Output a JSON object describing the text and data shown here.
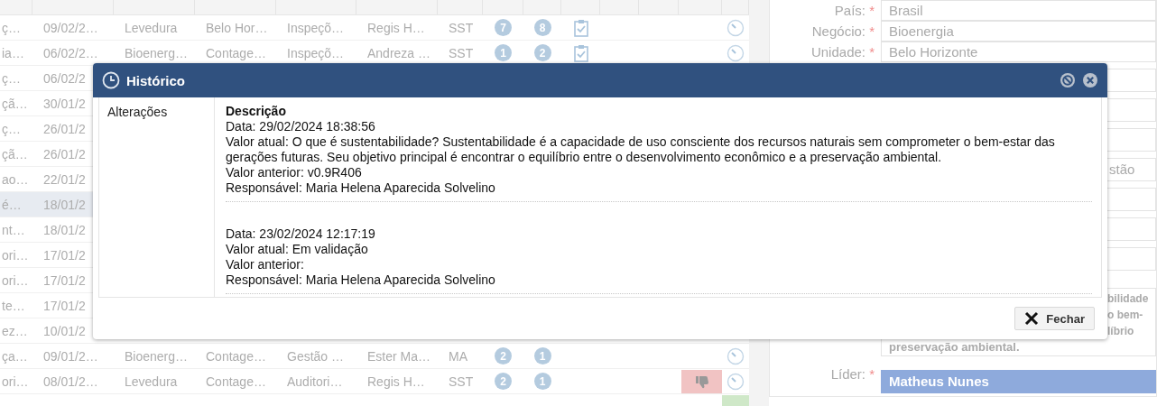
{
  "table": {
    "rows": [
      {
        "cells": [
          "ç…",
          "09/02/2…",
          "Levedura",
          "Belo Hor…",
          "Inspeçõ…",
          "Regis H…",
          "SST"
        ],
        "selected": false,
        "badges": [
          "7",
          "8"
        ],
        "task": true,
        "rejected": false,
        "approved": false,
        "timer": true
      },
      {
        "cells": [
          "ia…",
          "06/02/2…",
          "Bioenerg…",
          "Contage…",
          "Inspeçõ…",
          "Andreza …",
          "SST"
        ],
        "selected": false,
        "badges": [
          "1",
          "2"
        ],
        "task": true,
        "rejected": false,
        "approved": false,
        "timer": true
      },
      {
        "cells": [
          "ç…",
          "06/02/2"
        ],
        "selected": false
      },
      {
        "cells": [
          "çã…",
          "30/01/2"
        ],
        "selected": false
      },
      {
        "cells": [
          "ç…",
          "26/01/2"
        ],
        "selected": false
      },
      {
        "cells": [
          "çã…",
          "26/01/2"
        ],
        "selected": false
      },
      {
        "cells": [
          "ao…",
          "22/01/2"
        ],
        "selected": false
      },
      {
        "cells": [
          "é…",
          "18/01/2"
        ],
        "selected": true
      },
      {
        "cells": [
          "nt…",
          "18/01/2"
        ],
        "selected": false
      },
      {
        "cells": [
          "ori…",
          "17/01/2"
        ],
        "selected": false
      },
      {
        "cells": [
          "ori…",
          "17/01/2"
        ],
        "selected": false
      },
      {
        "cells": [
          "te…",
          "17/01/2"
        ],
        "selected": false
      },
      {
        "cells": [
          "ez…",
          "10/01/2"
        ],
        "selected": false
      },
      {
        "cells": [
          "ça…",
          "09/01/2…",
          "Bioenerg…",
          "Contage…",
          "Gestão …",
          "Ester Ma…",
          "MA"
        ],
        "selected": false,
        "badges": [
          "2",
          "1"
        ],
        "task": false,
        "rejected": false,
        "approved": false,
        "timer": true
      },
      {
        "cells": [
          "ori…",
          "08/01/2…",
          "Levedura",
          "Contage…",
          "Auditori…",
          "Regis H…",
          "SST"
        ],
        "selected": false,
        "badges": [
          "2",
          "1"
        ],
        "task": false,
        "rejected": true,
        "approved": false,
        "timer": true
      },
      {
        "cells": [],
        "selected": false,
        "rejected": false,
        "approved": true
      }
    ]
  },
  "form": {
    "fields": [
      {
        "kind": "text",
        "label": "País:",
        "required_mark": "*",
        "value": "Brasil",
        "clipped": false
      },
      {
        "kind": "text",
        "label": "Negócio:",
        "required_mark": "*",
        "value": "Bioenergia",
        "clipped": false
      },
      {
        "kind": "text",
        "label": "Unidade:",
        "required_mark": "*",
        "value": "Belo Horizonte",
        "clipped": false
      },
      {
        "kind": "text",
        "clipped": true
      },
      {
        "kind": "text",
        "clipped": true
      },
      {
        "kind": "text",
        "clipped": true
      },
      {
        "kind": "text",
        "value": "stão",
        "clipped": true
      },
      {
        "kind": "text",
        "clipped": true
      },
      {
        "kind": "text",
        "clipped": true
      },
      {
        "kind": "text",
        "clipped": true
      },
      {
        "kind": "textarea",
        "lines": [
          {
            "text": "bilidade",
            "clipped": true
          },
          {
            "text": "o bem-",
            "clipped": true
          },
          {
            "text": "líbrio",
            "clipped": true
          },
          {
            "text": "preservação ambiental.",
            "clipped": false
          }
        ]
      },
      {
        "kind": "highlight",
        "label": "Líder:",
        "required_mark": "*",
        "value": "Matheus Nunes"
      }
    ]
  },
  "dialog": {
    "title": "Histórico",
    "section_label": "Alterações",
    "close_button": "Fechar",
    "entries": [
      {
        "title": "Descrição",
        "lines": [
          "Data: 29/02/2024 18:38:56",
          "Valor atual: O que é sustentabilidade? Sustentabilidade é a capacidade de uso consciente dos recursos naturais sem comprometer o bem-estar das gerações futuras. Seu objetivo principal é encontrar o equilíbrio entre o desenvolvimento econômico e a preservação ambiental.",
          "Valor anterior: v0.9R406",
          "Responsável: Maria Helena Aparecida Solvelino"
        ]
      },
      {
        "lines": [
          "Data: 23/02/2024 12:17:19",
          "Valor atual: Em validação",
          "Valor anterior:",
          "Responsável: Maria Helena Aparecida Solvelino"
        ]
      }
    ]
  }
}
